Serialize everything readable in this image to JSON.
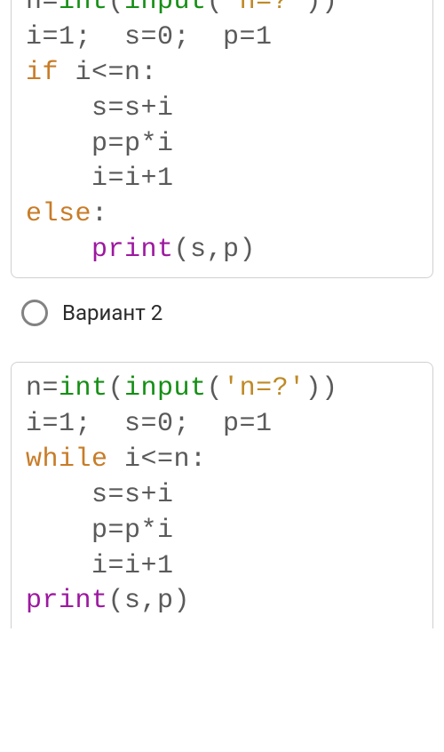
{
  "option": {
    "label": "Вариант 2"
  },
  "code1": {
    "l1a": "n=",
    "l1_int": "int",
    "l1b": "(",
    "l1_input": "input",
    "l1c": "(",
    "l1_str": "'n=?'",
    "l1d": "))",
    "l2": "i=1;  s=0;  p=1",
    "l3_if": "if",
    "l3b": " i<=n:",
    "l4": "    s=s+i",
    "l5": "    p=p*i",
    "l6": "    i=i+1",
    "l7_else": "else",
    "l7b": ":",
    "l8a": "    ",
    "l8_print": "print",
    "l8b": "(s,p)"
  },
  "code2": {
    "l1a": "n=",
    "l1_int": "int",
    "l1b": "(",
    "l1_input": "input",
    "l1c": "(",
    "l1_str": "'n=?'",
    "l1d": "))",
    "l2": "i=1;  s=0;  p=1",
    "l3_while": "while",
    "l3b": " i<=n:",
    "l4": "    s=s+i",
    "l5": "    p=p*i",
    "l6": "    i=i+1",
    "l7_print": "print",
    "l7b": "(s,p)"
  }
}
